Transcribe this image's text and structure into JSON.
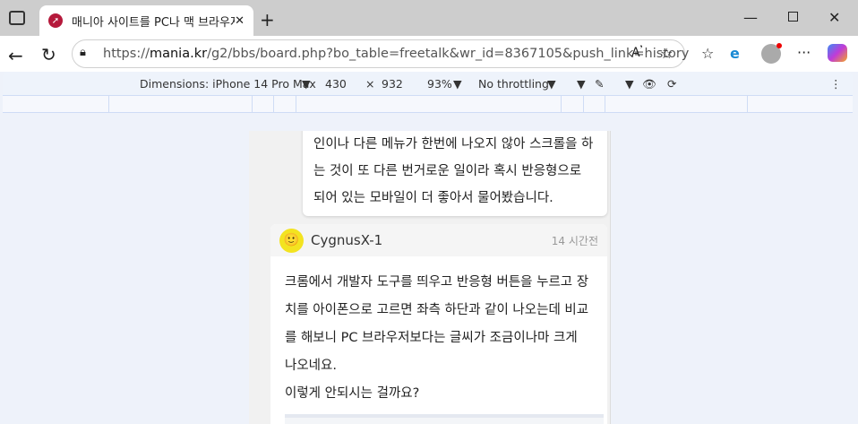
{
  "tab": {
    "title": "매니아 사이트를 PC나 맥 브라우저",
    "favicon": "mania-logo"
  },
  "address": {
    "scheme": "https://",
    "domain": "mania.kr",
    "path": "/g2/bbs/board.php?bo_table=freetalk&wr_id=8367105&push_link=history"
  },
  "devtools": {
    "dimensions": "Dimensions: iPhone 14 Pro Max",
    "width": "430",
    "times": "×",
    "height": "932",
    "zoom": "93%",
    "throttling": "No throttling"
  },
  "quote": {
    "text": "인이나 다른 메뉴가 한번에 나오지 않아 스크롤을 하는 것이 또 다른 번거로운 일이라 혹시 반응형으로 되어 있는 모바일이 더 좋아서 물어봤습니다."
  },
  "comment": {
    "author": "CygnusX-1",
    "time": "14 시간전",
    "text": "크롬에서 개발자 도구를 띄우고 반응형 버튼을 누르고 장치를 아이폰으로 고르면 좌측 하단과 같이 나오는데 비교를 해보니 PC 브라우저보다는 글씨가 조금이나마 크게 나오네요.",
    "text2": "이렇게 안되시는 걸까요?"
  }
}
